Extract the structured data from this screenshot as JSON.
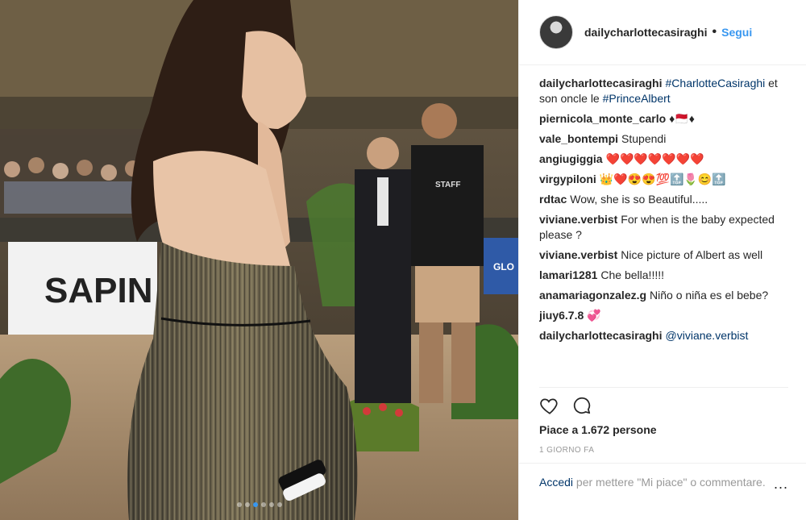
{
  "header": {
    "username": "dailycharlottecasiraghi",
    "separator": "•",
    "follow_label": "Segui"
  },
  "photo": {
    "banner_text": "SAPIN",
    "shirt_text": "STAFF",
    "side_banner_text": "GLO",
    "carousel_dots": 6,
    "active_dot": 3
  },
  "comments": [
    {
      "user": "dailycharlottecasiraghi",
      "parts": [
        {
          "tag": "#CharlotteCasiraghi"
        },
        {
          "text": " et son oncle le "
        },
        {
          "tag": "#PrinceAlbert"
        }
      ]
    },
    {
      "user": "piernicola_monte_carlo",
      "parts": [
        {
          "text": "♦🇲🇨♦"
        }
      ]
    },
    {
      "user": "vale_bontempi",
      "parts": [
        {
          "text": "Stupendi"
        }
      ]
    },
    {
      "user": "angiugiggia",
      "parts": [
        {
          "text": "❤️❤️❤️❤️❤️❤️❤️"
        }
      ]
    },
    {
      "user": "virgypiloni",
      "parts": [
        {
          "text": "👑❤️😍😍💯🔝🌷😊🔝"
        }
      ]
    },
    {
      "user": "rdtac",
      "parts": [
        {
          "text": "Wow, she is so Beautiful....."
        }
      ]
    },
    {
      "user": "viviane.verbist",
      "parts": [
        {
          "text": "For when is the baby expected please ?"
        }
      ]
    },
    {
      "user": "viviane.verbist",
      "parts": [
        {
          "text": "Nice picture of Albert as well"
        }
      ]
    },
    {
      "user": "lamari1281",
      "parts": [
        {
          "text": "Che bella!!!!!"
        }
      ]
    },
    {
      "user": "anamariagonzalez.g",
      "parts": [
        {
          "text": "Niño o niña es el bebe?"
        }
      ]
    },
    {
      "user": "jiuy6.7.8",
      "parts": [
        {
          "text": "💞"
        }
      ]
    },
    {
      "user": "dailycharlottecasiraghi",
      "parts": [
        {
          "tag": "@viviane.verbist"
        }
      ]
    }
  ],
  "actions": {
    "like_icon": "heart-outline-icon",
    "comment_icon": "speech-bubble-icon",
    "likes_label": "Piace a 1.672 persone",
    "timestamp": "1 GIORNO FA"
  },
  "footer": {
    "login_label": "Accedi",
    "rest_text": " per mettere \"Mi piace\" o commentare.",
    "more_label": "..."
  },
  "colors": {
    "accent": "#3897f0",
    "link": "#003569",
    "muted": "#999999",
    "border": "#efefef"
  }
}
